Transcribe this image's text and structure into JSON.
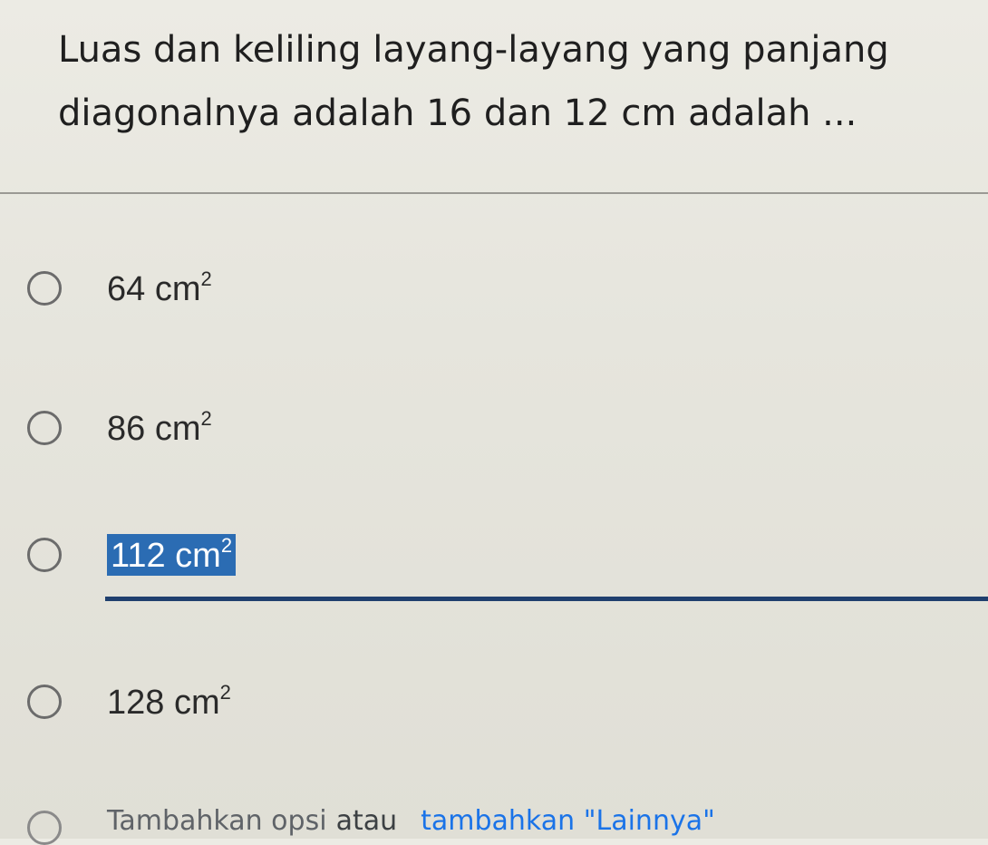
{
  "question": {
    "line1": "Luas dan keliling layang-layang yang panjang",
    "line2": "diagonalnya adalah 16 dan 12 cm adalah ..."
  },
  "options": [
    {
      "value": "64",
      "unit": "cm",
      "power": "2"
    },
    {
      "value": "86",
      "unit": "cm",
      "power": "2"
    },
    {
      "value": "112",
      "unit": "cm",
      "power": "2"
    },
    {
      "value": "128",
      "unit": "cm",
      "power": "2"
    }
  ],
  "add_row": {
    "add_option": "Tambahkan opsi",
    "or": "atau",
    "add_other": "tambahkan \"Lainnya\""
  },
  "colors": {
    "highlight": "#2b6cb3",
    "link": "#1a73e8"
  }
}
